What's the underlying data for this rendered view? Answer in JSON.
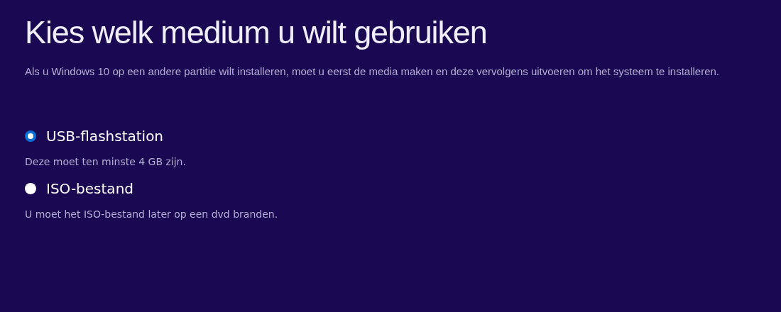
{
  "title": "Kies welk medium u wilt gebruiken",
  "description": "Als u Windows 10 op een andere partitie wilt installeren, moet u eerst de media maken en deze vervolgens uitvoeren om het systeem te installeren.",
  "options": [
    {
      "label": "USB-flashstation",
      "hint": "Deze moet ten minste 4 GB zijn.",
      "selected": true
    },
    {
      "label": "ISO-bestand",
      "hint": "U moet het ISO-bestand later op een dvd branden.",
      "selected": false
    }
  ]
}
